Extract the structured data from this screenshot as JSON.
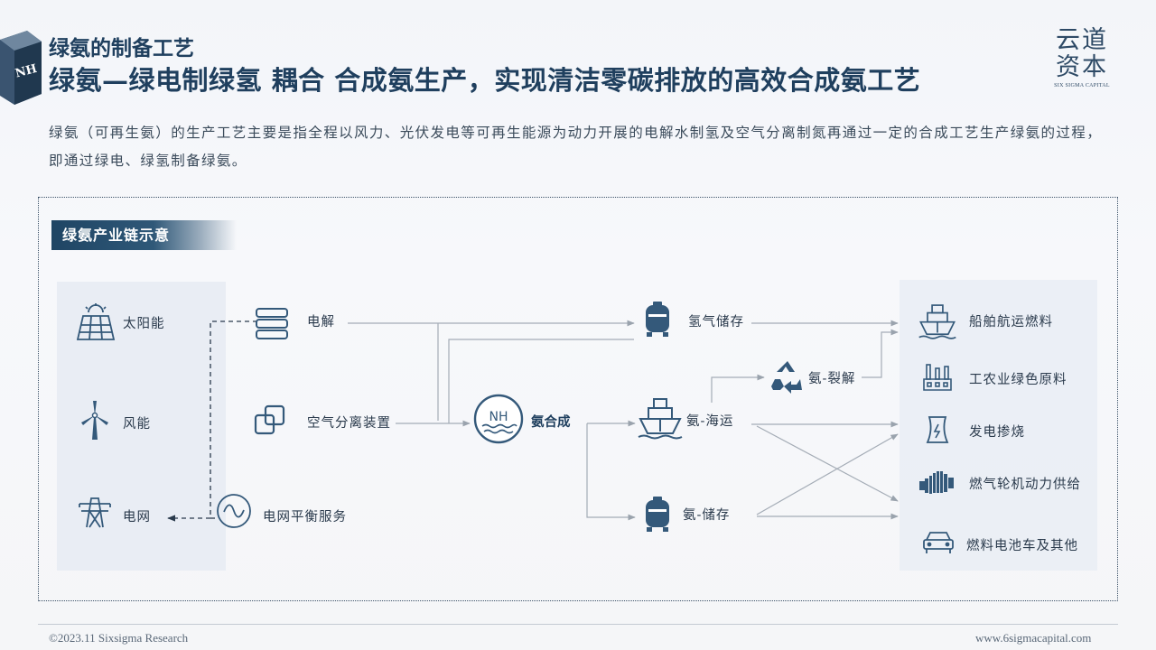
{
  "header": {
    "badge_text": "NH",
    "kicker": "绿氨的制备工艺",
    "headline": "绿氨—绿电制绿氢 耦合 合成氨生产，实现清洁零碳排放的高效合成氨工艺",
    "logo_line1": "云道",
    "logo_line2": "资本",
    "logo_sub": "SIX SIGMA CAPITAL"
  },
  "intro": "绿氨（可再生氨）的生产工艺主要是指全程以风力、光伏发电等可再生能源为动力开展的电解水制氢及空气分离制氮再通过一定的合成工艺生产绿氨的过程，即通过绿电、绿氢制备绿氨。",
  "diagram": {
    "chip_label": "绿氨产业链示意",
    "sources": [
      {
        "label": "太阳能",
        "icon": "solar-panel-icon"
      },
      {
        "label": "风能",
        "icon": "wind-turbine-icon"
      },
      {
        "label": "电网",
        "icon": "power-tower-icon"
      }
    ],
    "electrolysis": "电解",
    "air_separation": "空气分离装置",
    "grid_balance": "电网平衡服务",
    "synthesis": "氨合成",
    "synthesis_badge": "NH",
    "hydrogen_storage": "氢气储存",
    "ammonia_cracking": "氨-裂解",
    "ammonia_shipping": "氨-海运",
    "ammonia_storage": "氨-储存",
    "uses": [
      {
        "label": "船舶航运燃料",
        "icon": "ship-icon"
      },
      {
        "label": "工农业绿色原料",
        "icon": "factory-icon"
      },
      {
        "label": "发电掺烧",
        "icon": "power-plant-icon"
      },
      {
        "label": "燃气轮机动力供给",
        "icon": "gas-turbine-icon"
      },
      {
        "label": "燃料电池车及其他",
        "icon": "car-icon"
      }
    ]
  },
  "footer": {
    "copyright": "©2023.11 Sixsigma Research",
    "website": "www.6sigmacapital.com"
  },
  "colors": {
    "navy": "#1f3f5e",
    "icon_blue": "#34597a",
    "line_gray": "#a4acb6"
  }
}
